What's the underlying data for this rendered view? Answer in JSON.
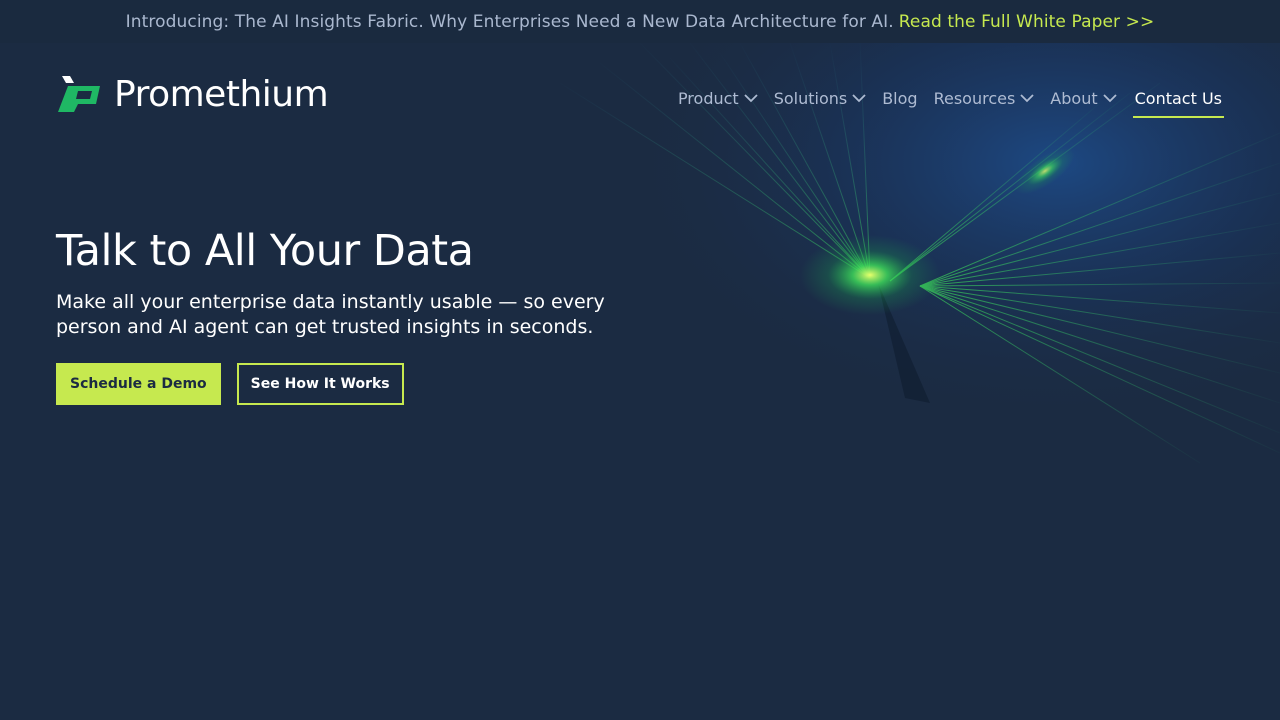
{
  "announcement": {
    "text": "Introducing: The AI Insights Fabric. Why Enterprises Need a New Data Architecture for AI.",
    "link_label": "Read the Full White Paper >>"
  },
  "brand": {
    "name": "Promethium",
    "accent": "#c6e94f",
    "logo_green": "#1fb864",
    "background": "#1b2b42"
  },
  "nav": {
    "items": [
      {
        "label": "Product",
        "has_dropdown": true
      },
      {
        "label": "Solutions",
        "has_dropdown": true
      },
      {
        "label": "Blog",
        "has_dropdown": false
      },
      {
        "label": "Resources",
        "has_dropdown": true
      },
      {
        "label": "About",
        "has_dropdown": true
      }
    ],
    "contact_label": "Contact Us"
  },
  "hero": {
    "title": "Talk to All Your Data",
    "subtitle": "Make all your enterprise data instantly usable — so every person and AI agent can get trusted insights in seconds.",
    "primary_cta": "Schedule a Demo",
    "secondary_cta": "See How It Works"
  },
  "icons": {
    "dropdown": "chevron-down-icon",
    "logo": "promethium-logo-icon"
  }
}
